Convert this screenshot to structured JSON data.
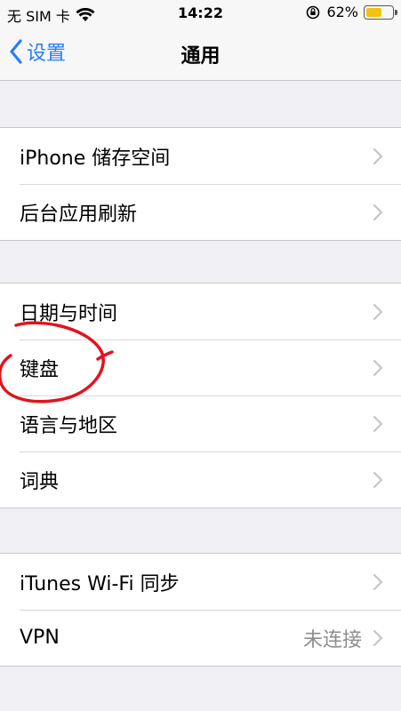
{
  "status_bar": {
    "carrier": "无 SIM 卡",
    "time": "14:22",
    "battery_percent": "62%",
    "battery_level": 0.62
  },
  "nav": {
    "back_label": "设置",
    "title": "通用"
  },
  "groups": [
    {
      "rows": [
        {
          "label": "iPhone 储存空间"
        },
        {
          "label": "后台应用刷新"
        }
      ]
    },
    {
      "rows": [
        {
          "label": "日期与时间"
        },
        {
          "label": "键盘"
        },
        {
          "label": "语言与地区"
        },
        {
          "label": "词典"
        }
      ]
    },
    {
      "rows": [
        {
          "label": "iTunes Wi-Fi 同步"
        },
        {
          "label": "VPN",
          "value": "未连接"
        }
      ]
    }
  ],
  "colors": {
    "accent": "#2a7cf6",
    "annotation": "#e0141e",
    "background": "#efeff4"
  }
}
